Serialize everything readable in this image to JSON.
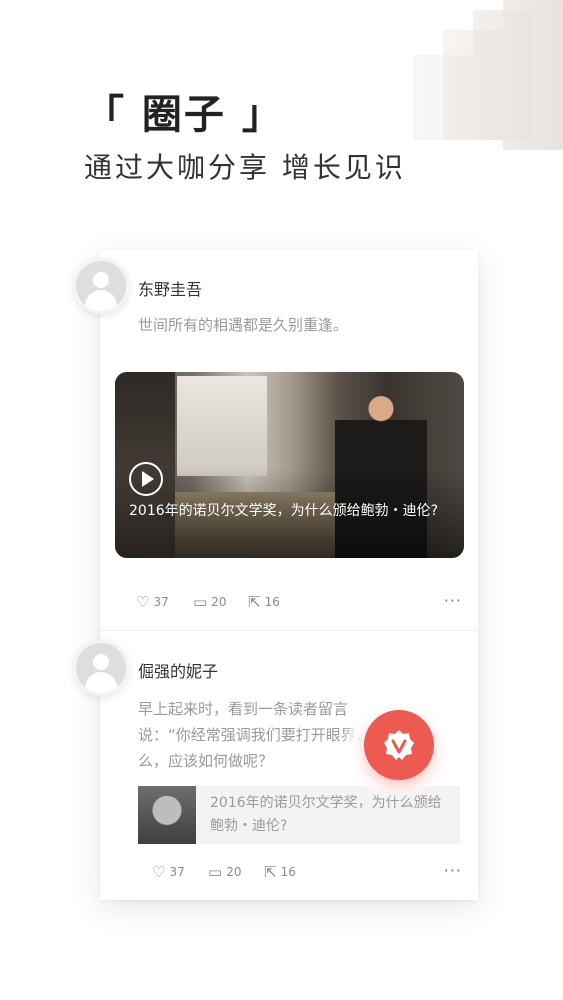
{
  "hero": {
    "title": "「 圈子 」",
    "subtitle": "通过大咖分享 增长见识"
  },
  "posts": [
    {
      "username": "东野圭吾",
      "text": "世间所有的相遇都是久别重逢。",
      "video_caption": "2016年的诺贝尔文学奖，为什么颁给鲍勃・迪伦?",
      "likes": "37",
      "comments": "20",
      "shares": "16",
      "more": "···"
    },
    {
      "username": "倔强的妮子",
      "text": "早上起来时，看到一条读者留言说：“你经常强调我们要打开眼界，那么，应该如何做呢？",
      "link_title": "2016年的诺贝尔文学奖，为什么颁给鲍勃・迪伦?",
      "likes": "37",
      "comments": "20",
      "shares": "16",
      "more": "···"
    }
  ],
  "icons": {
    "like": "like-icon",
    "comment": "comment-icon",
    "share": "share-icon",
    "play": "play-icon",
    "avatar": "avatar-placeholder",
    "fab": "v-badge-icon"
  },
  "colors": {
    "accent": "#ec5a50",
    "muted_text": "#9a9a9a"
  }
}
